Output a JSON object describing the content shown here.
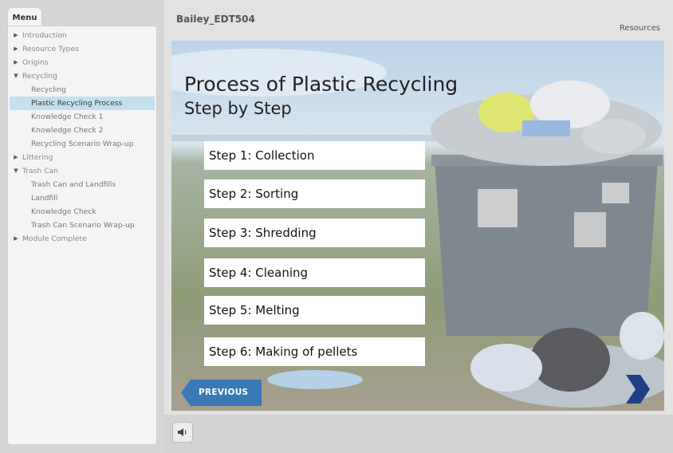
{
  "header": {
    "course_title": "Bailey_EDT504",
    "resources_label": "Resources"
  },
  "menu": {
    "tab_label": "Menu",
    "items": [
      {
        "label": "Introduction",
        "level": 0,
        "caret": "▶"
      },
      {
        "label": "Resource Types",
        "level": 0,
        "caret": "▶"
      },
      {
        "label": "Origins",
        "level": 0,
        "caret": "▶"
      },
      {
        "label": "Recycling",
        "level": 0,
        "caret": "▼"
      },
      {
        "label": "Recycling",
        "level": 1
      },
      {
        "label": "Plastic Recycling Process",
        "level": 1,
        "active": true
      },
      {
        "label": "Knowledge Check 1",
        "level": 1
      },
      {
        "label": "Knowledge Check 2",
        "level": 1
      },
      {
        "label": "Recycling Scenario Wrap-up",
        "level": 1
      },
      {
        "label": "Littering",
        "level": 0,
        "caret": "▶"
      },
      {
        "label": "Trash Can",
        "level": 0,
        "caret": "▼"
      },
      {
        "label": "Trash Can and Landfills",
        "level": 1
      },
      {
        "label": "Landfill",
        "level": 1
      },
      {
        "label": "Knowledge Check",
        "level": 1
      },
      {
        "label": "Trash Can Scenario Wrap-up",
        "level": 1
      },
      {
        "label": "Module Complete",
        "level": 0,
        "caret": "▶"
      }
    ]
  },
  "slide": {
    "title": "Process of Plastic Recycling",
    "subtitle": "Step by Step",
    "steps": [
      "Step 1: Collection",
      "Step 2: Sorting",
      "Step 3: Shredding",
      "Step 4: Cleaning",
      "Step 5: Melting",
      "Step 6: Making of pellets"
    ]
  },
  "nav": {
    "previous_label": "PREVIOUS",
    "next_icon": "chevron-right-icon",
    "audio_icon": "speaker-icon"
  },
  "colors": {
    "accent": "#3a78b6",
    "active_menu": "#c4e0ee",
    "next_chevron": "#1f3f86"
  }
}
